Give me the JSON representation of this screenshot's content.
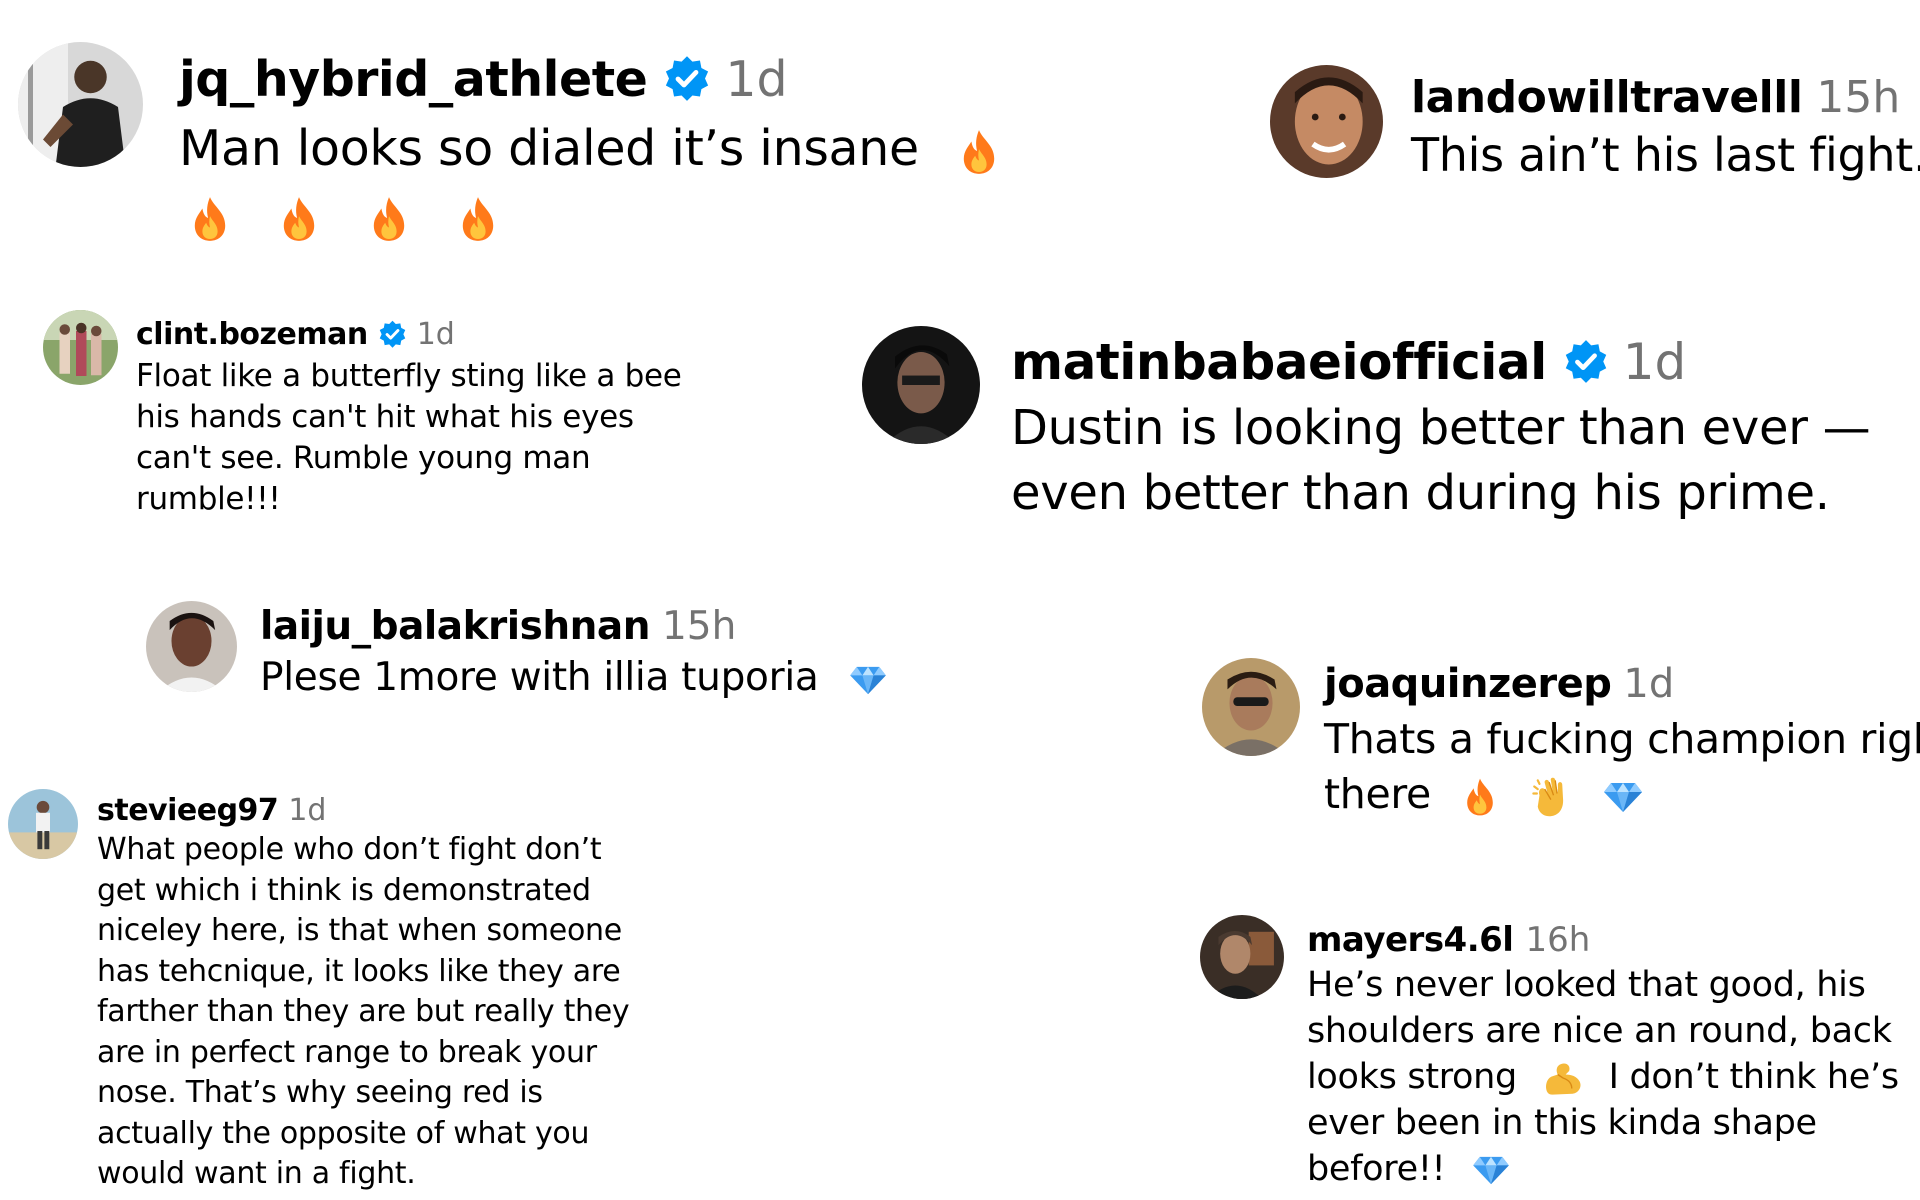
{
  "colors": {
    "username": "#000000",
    "timestamp": "#737373",
    "verified_badge": "#0095F6",
    "fire": "#FF7A1A",
    "diamond": "#3B9BF0"
  },
  "comments": [
    {
      "username": "jq_hybrid_athlete",
      "verified": true,
      "time": "1d",
      "lines": [
        "Man looks so dialed it’s insane"
      ],
      "emojis": [
        "fire-emoji",
        "fire-emoji",
        "fire-emoji",
        "fire-emoji",
        "fire-emoji"
      ]
    },
    {
      "username": "landowilltravelll",
      "verified": false,
      "time": "15h",
      "lines": [
        "This ain’t his last fight."
      ]
    },
    {
      "username": "clint.bozeman",
      "verified": true,
      "time": "1d",
      "lines": [
        "Float like a butterfly sting like a bee",
        "his hands can't hit what his eyes",
        "can't see. Rumble young man",
        "rumble!!!"
      ]
    },
    {
      "username": "matinbabaeiofficial",
      "verified": true,
      "time": "1d",
      "lines": [
        "Dustin is looking better than ever —",
        "even better than during his prime."
      ]
    },
    {
      "username": "laiju_balakrishnan",
      "verified": false,
      "time": "15h",
      "lines": [
        "Plese 1more with illia tuporia"
      ],
      "emojis": [
        "diamond-emoji"
      ]
    },
    {
      "username": "joaquinzerep",
      "verified": false,
      "time": "1d",
      "lines": [
        "Thats a fucking champion right",
        "there"
      ],
      "emojis": [
        "fire-emoji",
        "clapping-hands-emoji",
        "diamond-emoji"
      ]
    },
    {
      "username": "stevieeg97",
      "verified": false,
      "time": "1d",
      "lines": [
        "What people who don’t fight don’t",
        "get which i think is demonstrated",
        "niceley here, is that when someone",
        "has tehcnique, it looks like they are",
        "farther than they are but really they",
        "are in perfect range to break your",
        "nose. That’s why seeing red is",
        "actually the opposite of what you",
        "would want in a fight."
      ]
    },
    {
      "username": "mayers4.6l",
      "verified": false,
      "time": "16h",
      "lines": [
        "He’s never looked that good, his",
        "shoulders are nice an round, back",
        "looks strong",
        "I don’t think he’s",
        "ever been in this kinda shape",
        "before!!"
      ],
      "emojis": [
        "flexed-biceps-emoji",
        "diamond-emoji"
      ]
    }
  ]
}
